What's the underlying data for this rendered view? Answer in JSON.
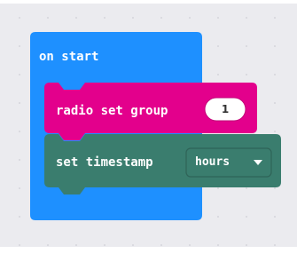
{
  "workspace": {
    "on_start_label": "on start",
    "on_start_color": "#1E90FF",
    "blocks": [
      {
        "label": "radio set group",
        "value": "1",
        "color": "#E3008C"
      },
      {
        "label": "set timestamp",
        "dropdown_value": "hours",
        "dropdown_icon": "caret-down-icon",
        "color": "#3A7D6E"
      }
    ]
  }
}
